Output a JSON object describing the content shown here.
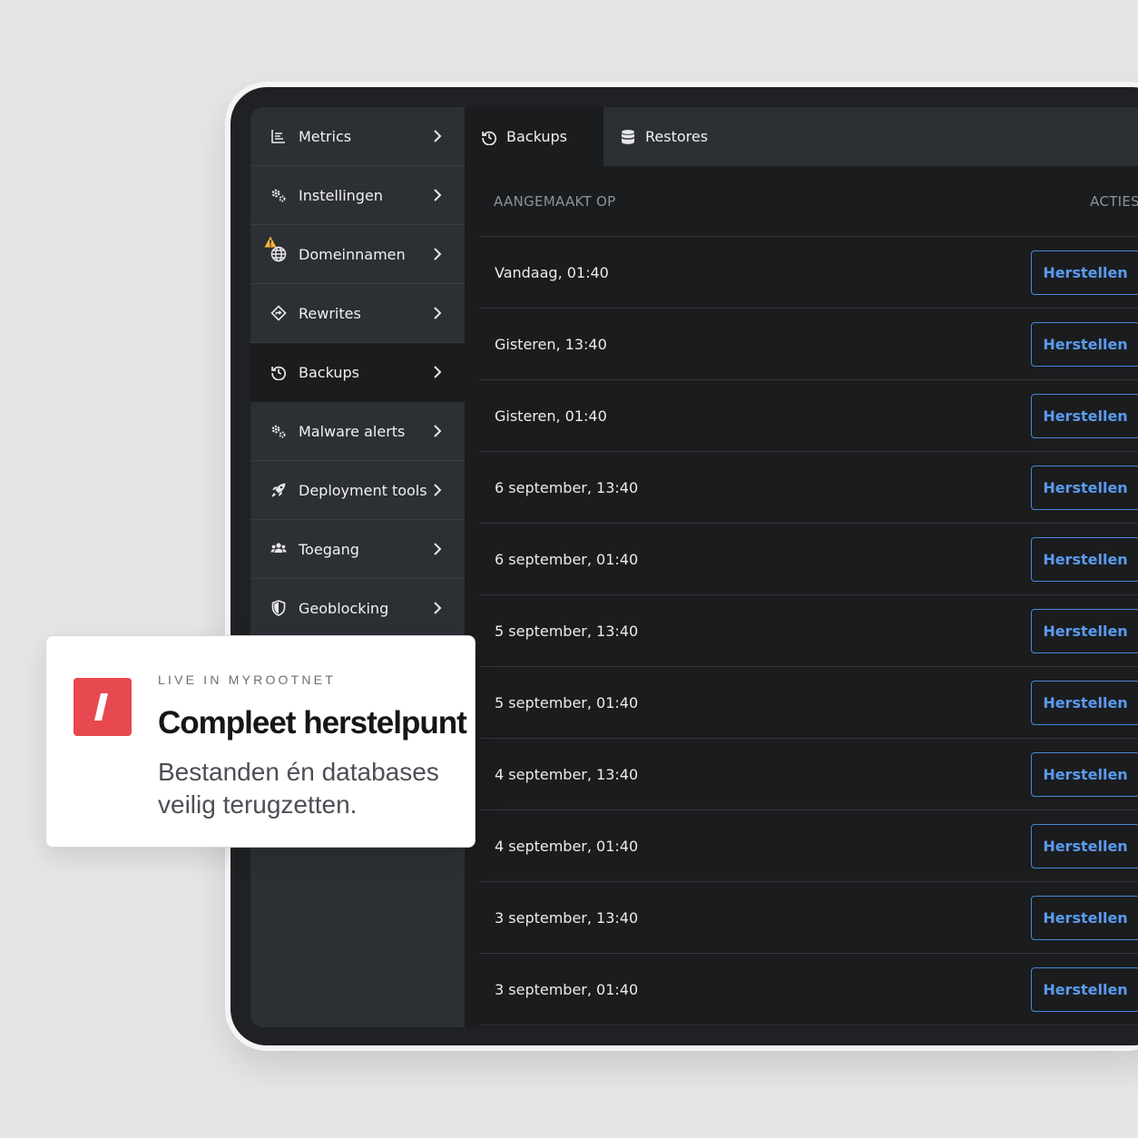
{
  "sidebar": {
    "items": [
      {
        "label": "Metrics",
        "icon": "metrics-icon"
      },
      {
        "label": "Instellingen",
        "icon": "gears-icon"
      },
      {
        "label": "Domeinnamen",
        "icon": "globe-icon",
        "warning": true
      },
      {
        "label": "Rewrites",
        "icon": "diamond-arrow-icon"
      },
      {
        "label": "Backups",
        "icon": "history-icon",
        "active": true
      },
      {
        "label": "Malware alerts",
        "icon": "gears-icon"
      },
      {
        "label": "Deployment tools",
        "icon": "rocket-icon"
      },
      {
        "label": "Toegang",
        "icon": "users-icon"
      },
      {
        "label": "Geoblocking",
        "icon": "shield-icon"
      }
    ]
  },
  "tabs": [
    {
      "label": "Backups",
      "icon": "history-icon",
      "active": true
    },
    {
      "label": "Restores",
      "icon": "database-icon"
    }
  ],
  "table": {
    "col_created": "AANGEMAAKT OP",
    "col_actions": "ACTIES",
    "rows": [
      {
        "date": "Vandaag, 01:40",
        "action": "Herstellen"
      },
      {
        "date": "Gisteren, 13:40",
        "action": "Herstellen"
      },
      {
        "date": "Gisteren, 01:40",
        "action": "Herstellen"
      },
      {
        "date": "6 september, 13:40",
        "action": "Herstellen"
      },
      {
        "date": "6 september, 01:40",
        "action": "Herstellen"
      },
      {
        "date": "5 september, 13:40",
        "action": "Herstellen"
      },
      {
        "date": "5 september, 01:40",
        "action": "Herstellen"
      },
      {
        "date": "4 september, 13:40",
        "action": "Herstellen"
      },
      {
        "date": "4 september, 01:40",
        "action": "Herstellen"
      },
      {
        "date": "3 september, 13:40",
        "action": "Herstellen"
      },
      {
        "date": "3 september, 01:40",
        "action": "Herstellen"
      }
    ]
  },
  "card": {
    "kicker": "LIVE IN MYROOTNET",
    "title": "Compleet herstelpunt",
    "body": "Bestanden én databases veilig terugzetten.",
    "logo_mark": "/"
  },
  "colors": {
    "accent_blue": "#5a9bf0",
    "brand_red": "#e8484f",
    "warning_yellow": "#f2b53a"
  }
}
